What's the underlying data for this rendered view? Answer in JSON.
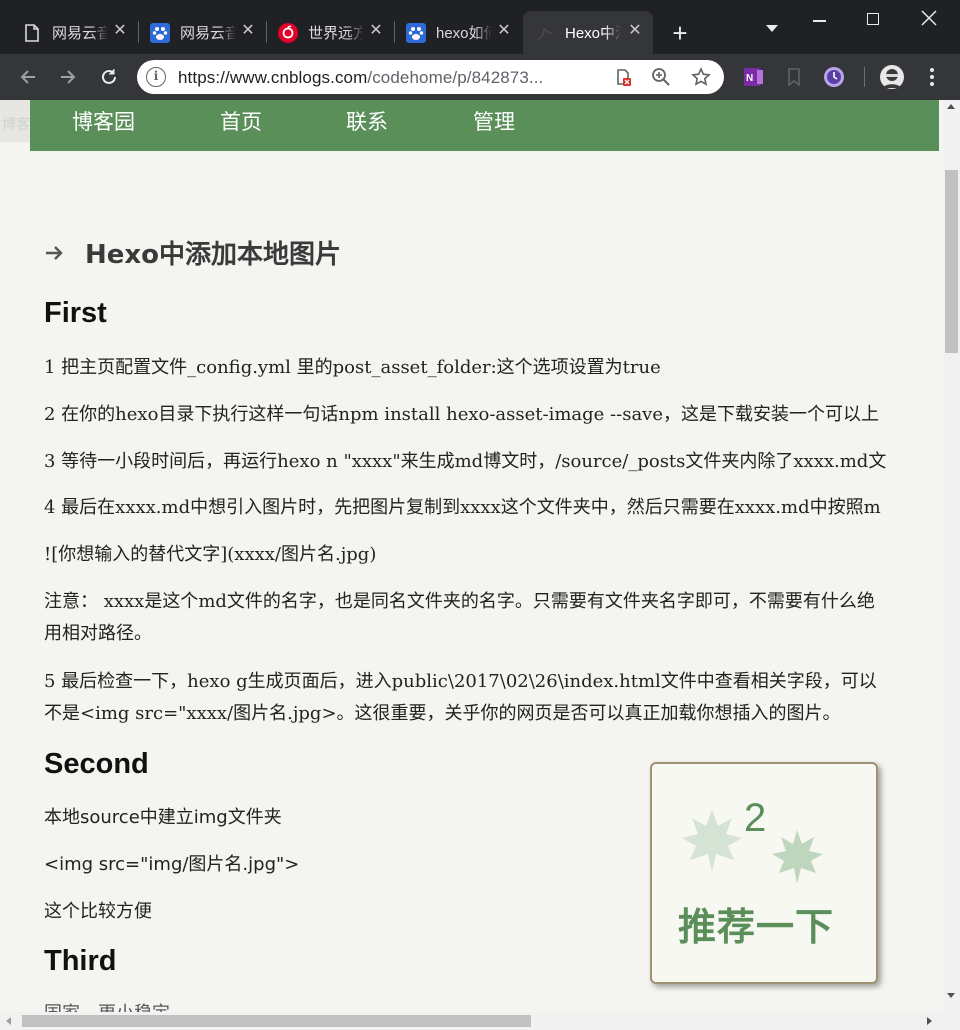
{
  "tabs": [
    {
      "title": "网易云音",
      "icon": "document-icon"
    },
    {
      "title": "网易云音",
      "icon": "baidu-paw-icon"
    },
    {
      "title": "世界远方",
      "icon": "netease-music-icon"
    },
    {
      "title": "hexo如何",
      "icon": "baidu-paw-icon"
    },
    {
      "title": "Hexo中添",
      "icon": "cnblogs-icon",
      "active": true
    }
  ],
  "omnibox": {
    "url_host": "https://www.cnblogs.com",
    "url_path": "/codehome/p/842873..."
  },
  "nav": {
    "stub": "博客",
    "items": [
      "博客园",
      "首页",
      "联系",
      "管理"
    ]
  },
  "post": {
    "title": "Hexo中添加本地图片",
    "sections": {
      "first": "First",
      "second": "Second",
      "third": "Third"
    },
    "lines": {
      "l1": "1 把主页配置文件_config.yml 里的post_asset_folder:这个选项设置为true",
      "l2": "2 在你的hexo目录下执行这样一句话npm install hexo-asset-image --save，这是下载安装一个可以上",
      "l3": "3 等待一小段时间后，再运行hexo n \"xxxx\"来生成md博文时，/source/_posts文件夹内除了xxxx.md文",
      "l4": "4 最后在xxxx.md中想引入图片时，先把图片复制到xxxx这个文件夹中，然后只需要在xxxx.md中按照m",
      "l5": "![你想输入的替代文字](xxxx/图片名.jpg)",
      "l6a": "注意： xxxx是这个md文件的名字，也是同名文件夹的名字。只需要有文件夹名字即可，不需要有什么绝",
      "l6b": "用相对路径。",
      "l7a": "5 最后检查一下，hexo g生成页面后，进入public\\2017\\02\\26\\index.html文件中查看相关字段，可以",
      "l7b": "不是<img src=\"xxxx/图片名.jpg>。这很重要，关乎你的网页是否可以真正加载你想插入的图片。",
      "s2a": "本地source中建立img文件夹",
      "s2b": "<img src=\"img/图片名.jpg\">",
      "s2c": "这个比较方便",
      "s3a": "国家、更小稳定"
    }
  },
  "recommend": {
    "count": "2",
    "label": "推荐一下"
  },
  "colors": {
    "accent": "#5a8f5a",
    "titlebar": "#202124",
    "toolbar": "#35363a",
    "page_bg": "#f4f4f1"
  }
}
